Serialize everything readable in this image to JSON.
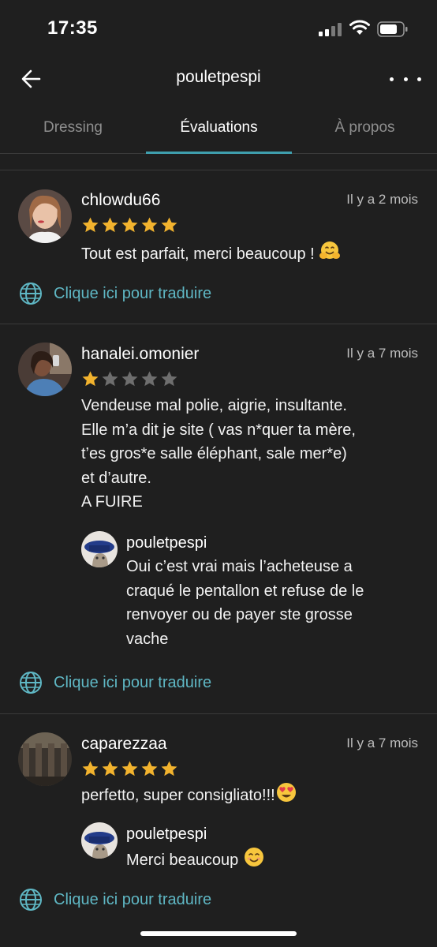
{
  "status_bar": {
    "time": "17:35"
  },
  "header": {
    "title": "pouletpespi"
  },
  "tabs": [
    {
      "label": "Dressing",
      "active": false
    },
    {
      "label": "Évaluations",
      "active": true
    },
    {
      "label": "À propos",
      "active": false
    }
  ],
  "reviews": [
    {
      "username": "chlowdu66",
      "time": "Il y a 2 mois",
      "rating": 5,
      "text": "Tout est parfait, merci beaucoup !",
      "emoji": "hugging-face",
      "translate_label": "Clique ici pour traduire"
    },
    {
      "username": "hanalei.omonier",
      "time": "Il y a 7 mois",
      "rating": 1,
      "text": "Vendeuse mal polie, aigrie, insultante.\nElle m’a dit je site ( vas n*quer ta mère,\nt’es gros*e salle éléphant, sale mer*e)\net d’autre.\nA FUIRE",
      "reply": {
        "username": "pouletpespi",
        "text": "Oui c’est vrai mais l’acheteuse a\ncraqué le pentallon et refuse de le\nrenvoyer ou de payer ste grosse\nvache"
      },
      "translate_label": "Clique ici pour traduire"
    },
    {
      "username": "caparezzaa",
      "time": "Il y a 7 mois",
      "rating": 5,
      "text": "perfetto, super consigliato!!!",
      "emoji": "heart-eyes",
      "reply": {
        "username": "pouletpespi",
        "text": "Merci beaucoup",
        "emoji": "smiling-face"
      },
      "translate_label": "Clique ici pour traduire"
    }
  ],
  "colors": {
    "background": "#1f1f1f",
    "accent": "#3f9fae",
    "link": "#5fb7c4",
    "star_filled": "#f2b32e",
    "star_empty": "#6e6e6e"
  }
}
